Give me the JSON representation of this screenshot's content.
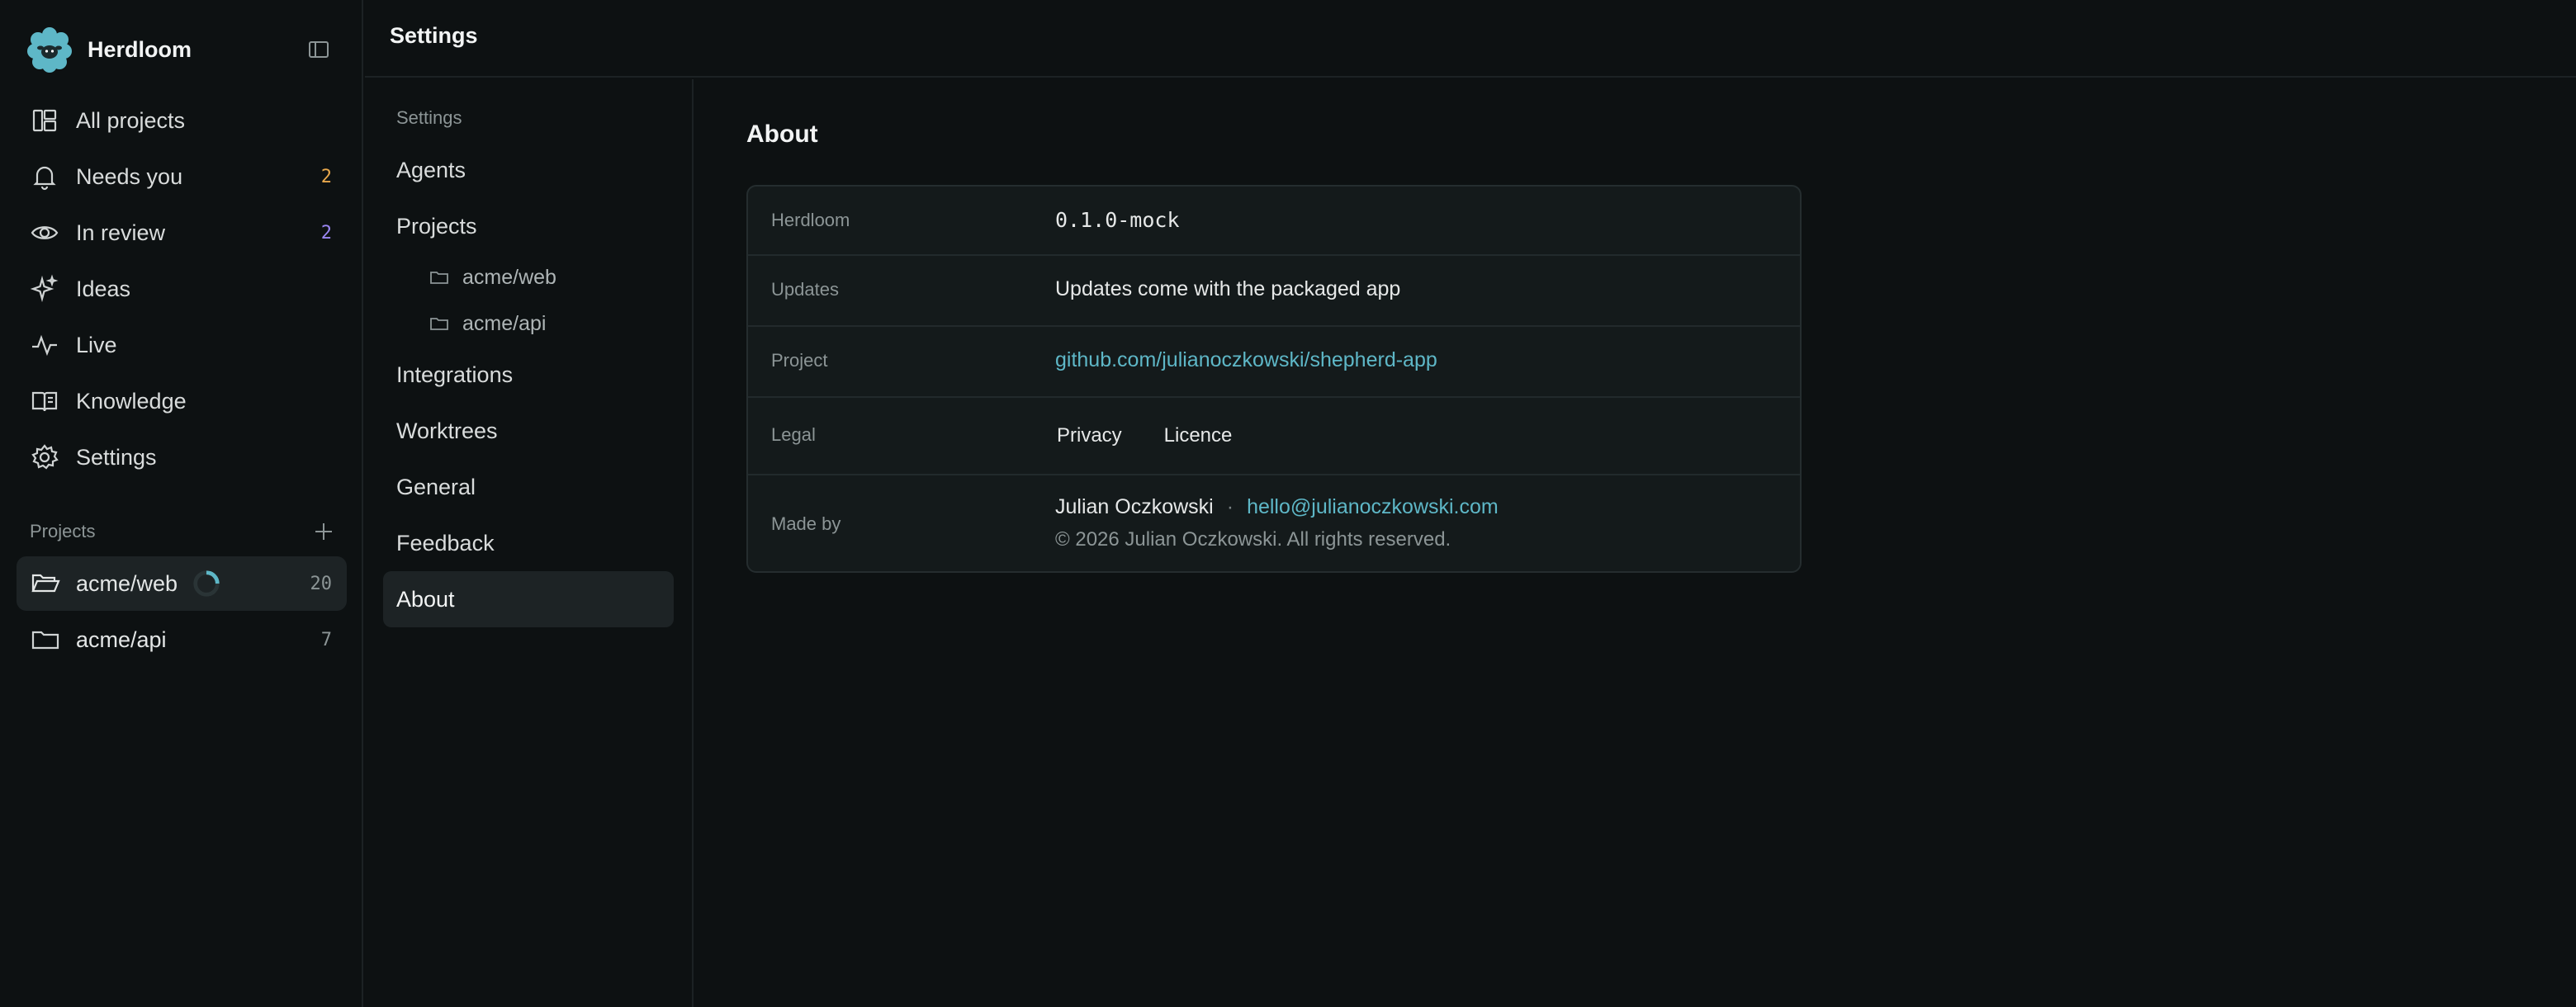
{
  "app": {
    "name": "Herdloom"
  },
  "colors": {
    "accent": "#5eb7c7",
    "needs_you": "#e8a84c",
    "in_review": "#9a86f2"
  },
  "nav": [
    {
      "label": "All projects",
      "icon": "grid-icon"
    },
    {
      "label": "Needs you",
      "icon": "bell-icon",
      "count": "2"
    },
    {
      "label": "In review",
      "icon": "eye-icon",
      "count": "2"
    },
    {
      "label": "Ideas",
      "icon": "sparkle-icon"
    },
    {
      "label": "Live",
      "icon": "activity-icon"
    },
    {
      "label": "Knowledge",
      "icon": "book-icon"
    },
    {
      "label": "Settings",
      "icon": "gear-icon"
    }
  ],
  "projects": {
    "title": "Projects",
    "items": [
      {
        "label": "acme/web",
        "count": "20",
        "icon": "folder-open-icon"
      },
      {
        "label": "acme/api",
        "count": "7",
        "icon": "folder-icon"
      }
    ]
  },
  "topbar": {
    "title": "Settings"
  },
  "settings_nav": {
    "heading": "Settings",
    "items": [
      "Agents",
      "Projects",
      "Integrations",
      "Worktrees",
      "General",
      "Feedback",
      "About"
    ],
    "sub_projects": [
      "acme/web",
      "acme/api"
    ],
    "active": "About"
  },
  "about": {
    "title": "About",
    "rows": {
      "herdloom": {
        "label": "Herdloom",
        "value": "0.1.0-mock"
      },
      "updates": {
        "label": "Updates",
        "value": "Updates come with the packaged app"
      },
      "project": {
        "label": "Project",
        "value": "github.com/julianoczkowski/shepherd-app"
      },
      "legal": {
        "label": "Legal",
        "privacy": "Privacy",
        "licence": "Licence"
      },
      "made_by": {
        "label": "Made by",
        "name": "Julian Oczkowski",
        "separator": "·",
        "email": "hello@julianoczkowski.com",
        "copyright": "© 2026 Julian Oczkowski. All rights reserved."
      }
    }
  }
}
